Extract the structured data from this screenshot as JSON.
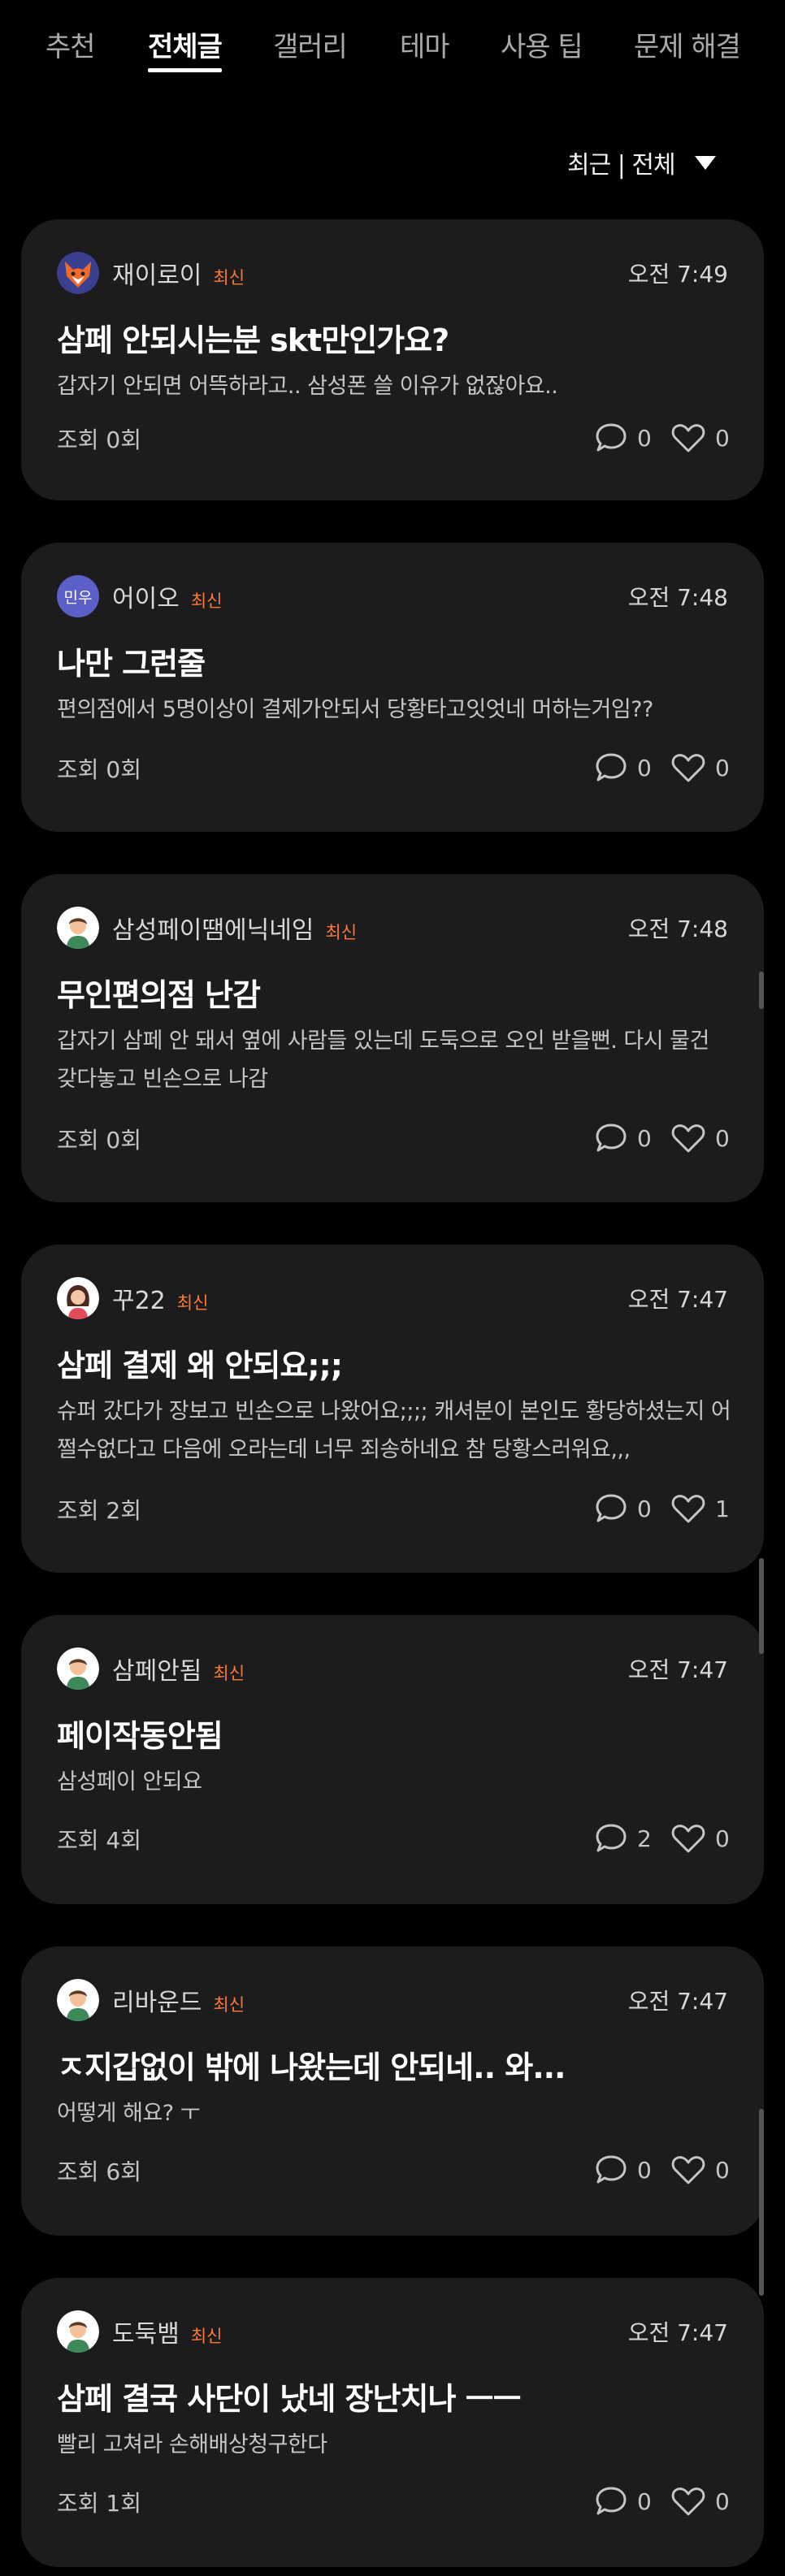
{
  "tabs": [
    {
      "label": "추천"
    },
    {
      "label": "전체글"
    },
    {
      "label": "갤러리"
    },
    {
      "label": "테마"
    },
    {
      "label": "사용 팁"
    },
    {
      "label": "문제 해결"
    }
  ],
  "filter": {
    "label": "최근 | 전체"
  },
  "posts": [
    {
      "author": "재이로이",
      "badge": "최신",
      "time": "오전 7:49",
      "title": "삼페 안되시는분 skt만인가요?",
      "preview": "갑자기 안되면 어뜩하라고.. 삼성폰 쓸 이유가 없잖아요..",
      "views": "조회 0회",
      "comments": "0",
      "likes": "0",
      "avatar": "fox-avatar"
    },
    {
      "author": "어이오",
      "badge": "최신",
      "time": "오전 7:48",
      "title": "나만 그런줄",
      "preview": "편의점에서 5명이상이 결제가안되서 당황타고잇엇네 머하는거임??",
      "views": "조회 0회",
      "comments": "0",
      "likes": "0",
      "avatar": "initial-avatar",
      "avatar_text": "민우"
    },
    {
      "author": "삼성페이땜에닉네임",
      "badge": "최신",
      "time": "오전 7:48",
      "title": "무인편의점 난감",
      "preview": "갑자기 삼페 안 돼서 옆에 사람들 있는데 도둑으로 오인 받을뻔. 다시 물건 갖다놓고 빈손으로 나감",
      "views": "조회 0회",
      "comments": "0",
      "likes": "0",
      "avatar": "man-avatar"
    },
    {
      "author": "꾸22",
      "badge": "최신",
      "time": "오전 7:47",
      "title": "삼페 결제 왜 안되요;;;",
      "preview": "슈퍼 갔다가 장보고 빈손으로 나왔어요;;;; 캐셔분이 본인도 황당하셨는지 어쩔수없다고 다음에 오라는데 너무 죄송하네요 참 당황스러워요,,,",
      "views": "조회 2회",
      "comments": "0",
      "likes": "1",
      "avatar": "woman-avatar"
    },
    {
      "author": "삼페안됨",
      "badge": "최신",
      "time": "오전 7:47",
      "title": "페이작동안됨",
      "preview": "삼성페이 안되요",
      "views": "조회 4회",
      "comments": "2",
      "likes": "0",
      "avatar": "man-avatar"
    },
    {
      "author": "리바운드",
      "badge": "최신",
      "time": "오전 7:47",
      "title": "ㅈ지갑없이 밖에 나왔는데 안되네.. 와...",
      "preview": "어떻게 해요? ㅜ",
      "views": "조회 6회",
      "comments": "0",
      "likes": "0",
      "avatar": "man-avatar"
    },
    {
      "author": "도둑뱀",
      "badge": "최신",
      "time": "오전 7:47",
      "title": "삼페 결국 사단이 났네 장난치나 ㅡㅡ",
      "preview": "빨리 고쳐라 손해배상청구한다",
      "views": "조회 1회",
      "comments": "0",
      "likes": "0",
      "avatar": "man-avatar"
    }
  ],
  "colors": {
    "background": "#000000",
    "card": "#1c1c1e",
    "badge": "#ff7a2e",
    "initial_avatar": "#5b5fc7"
  }
}
